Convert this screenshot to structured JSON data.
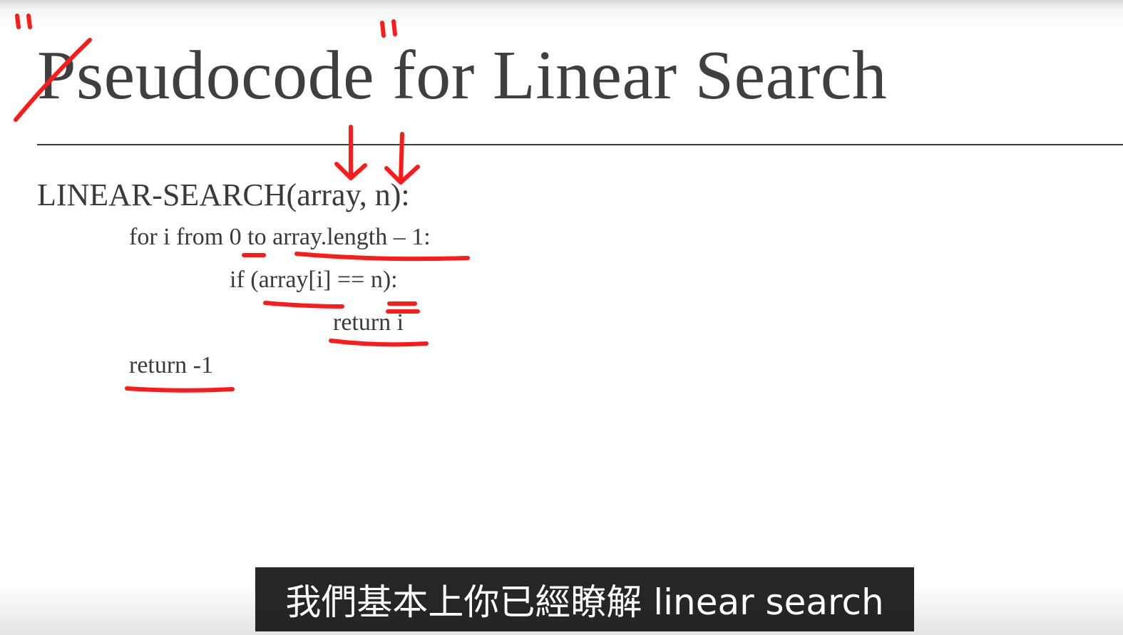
{
  "slide": {
    "title": "Pseudocode for Linear Search",
    "code": {
      "signature": "LINEAR-SEARCH(array, n):",
      "loop": "for i from 0 to array.length – 1:",
      "condition": "if  (array[i] == n):",
      "return_found": "return i",
      "return_not_found": "return -1"
    }
  },
  "subtitle": {
    "text": "我們基本上你已經瞭解 linear search"
  },
  "colors": {
    "annotation": "#ff1a1a",
    "text": "#3a3a3a",
    "caption_bg": "#141414"
  }
}
